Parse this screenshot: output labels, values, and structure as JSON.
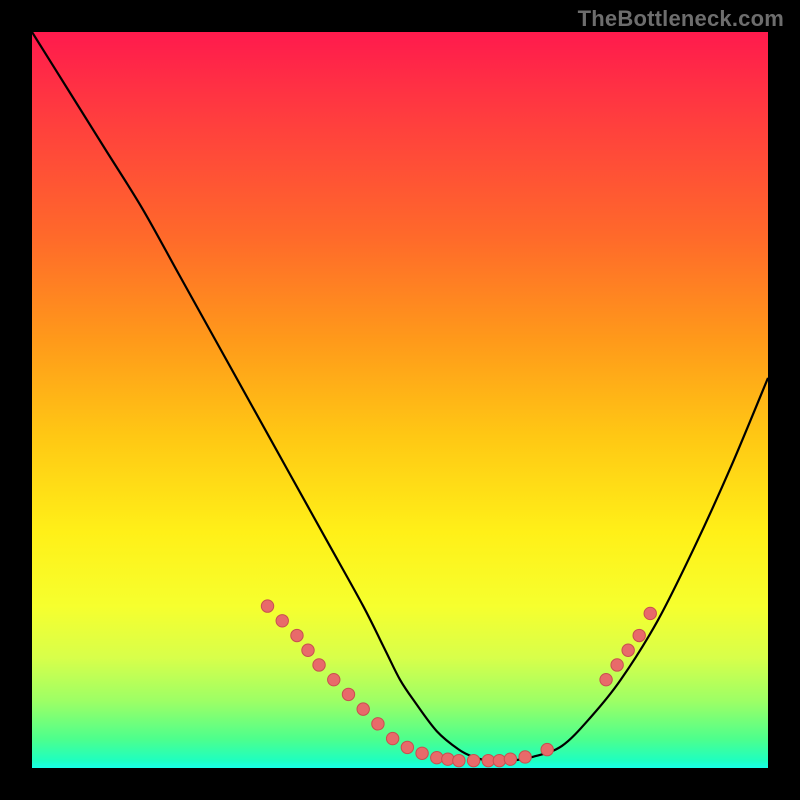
{
  "watermark": "TheBottleneck.com",
  "colors": {
    "frame": "#000000",
    "curve": "#000000",
    "dot_fill": "#e86a6a",
    "dot_stroke": "#c84f4f",
    "gradient_top": "#ff1a4d",
    "gradient_bottom": "#18ffe8"
  },
  "chart_data": {
    "type": "line",
    "title": "",
    "xlabel": "",
    "ylabel": "",
    "xlim": [
      0,
      100
    ],
    "ylim": [
      0,
      100
    ],
    "grid": false,
    "legend": false,
    "series": [
      {
        "name": "bottleneck-curve",
        "x": [
          0,
          5,
          10,
          15,
          20,
          25,
          30,
          35,
          40,
          45,
          48,
          50,
          52,
          55,
          58,
          60,
          62,
          65,
          68,
          72,
          76,
          80,
          85,
          90,
          95,
          100
        ],
        "y": [
          100,
          92,
          84,
          76,
          67,
          58,
          49,
          40,
          31,
          22,
          16,
          12,
          9,
          5,
          2.5,
          1.5,
          1,
          1,
          1.5,
          3,
          7,
          12,
          20,
          30,
          41,
          53
        ]
      }
    ],
    "markers": [
      {
        "x": 32,
        "y": 22
      },
      {
        "x": 34,
        "y": 20
      },
      {
        "x": 36,
        "y": 18
      },
      {
        "x": 37.5,
        "y": 16
      },
      {
        "x": 39,
        "y": 14
      },
      {
        "x": 41,
        "y": 12
      },
      {
        "x": 43,
        "y": 10
      },
      {
        "x": 45,
        "y": 8
      },
      {
        "x": 47,
        "y": 6
      },
      {
        "x": 49,
        "y": 4
      },
      {
        "x": 51,
        "y": 2.8
      },
      {
        "x": 53,
        "y": 2
      },
      {
        "x": 55,
        "y": 1.4
      },
      {
        "x": 56.5,
        "y": 1.2
      },
      {
        "x": 58,
        "y": 1
      },
      {
        "x": 60,
        "y": 1
      },
      {
        "x": 62,
        "y": 1
      },
      {
        "x": 63.5,
        "y": 1
      },
      {
        "x": 65,
        "y": 1.2
      },
      {
        "x": 67,
        "y": 1.5
      },
      {
        "x": 70,
        "y": 2.5
      },
      {
        "x": 78,
        "y": 12
      },
      {
        "x": 79.5,
        "y": 14
      },
      {
        "x": 81,
        "y": 16
      },
      {
        "x": 82.5,
        "y": 18
      },
      {
        "x": 84,
        "y": 21
      }
    ]
  }
}
